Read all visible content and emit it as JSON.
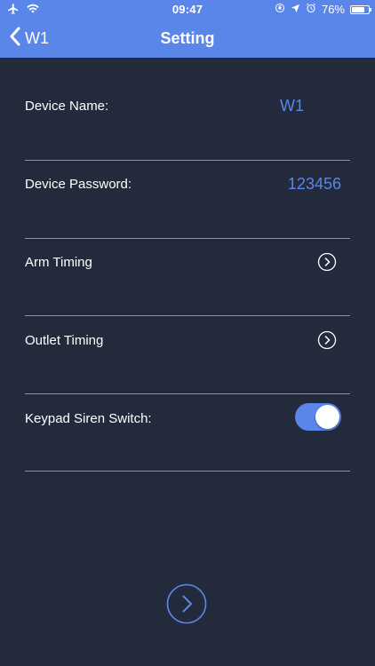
{
  "status_bar": {
    "time": "09:47",
    "battery": "76%",
    "battery_level": 0.76
  },
  "nav": {
    "back_label": "W1",
    "title": "Setting"
  },
  "settings": {
    "device_name_label": "Device Name:",
    "device_name_value": "W1",
    "device_password_label": "Device Password:",
    "device_password_value": "123456",
    "arm_timing_label": "Arm Timing",
    "outlet_timing_label": "Outlet Timing",
    "keypad_siren_label": "Keypad Siren Switch:",
    "keypad_siren_on": true
  },
  "colors": {
    "accent": "#5b86e9",
    "background": "#232a3b",
    "divider": "#8a91a3"
  }
}
